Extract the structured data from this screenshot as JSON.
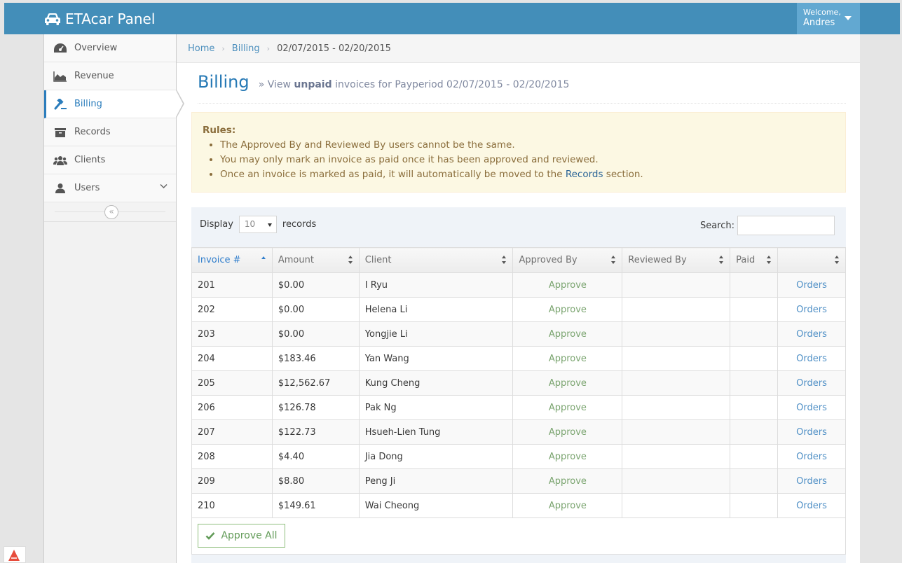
{
  "brand": {
    "title": "ETAcar Panel",
    "icon": "car-icon"
  },
  "user": {
    "welcome": "Welcome,",
    "name": "Andres"
  },
  "sidebar": {
    "items": [
      {
        "label": "Overview",
        "icon": "dashboard-icon"
      },
      {
        "label": "Revenue",
        "icon": "area-chart-icon"
      },
      {
        "label": "Billing",
        "icon": "gavel-icon",
        "active": true
      },
      {
        "label": "Records",
        "icon": "archive-icon"
      },
      {
        "label": "Clients",
        "icon": "users-icon"
      },
      {
        "label": "Users",
        "icon": "user-icon"
      }
    ],
    "collapse_glyph": "«"
  },
  "breadcrumb": {
    "home": "Home",
    "billing": "Billing",
    "current": "02/07/2015 - 02/20/2015"
  },
  "header": {
    "title": "Billing",
    "sub_prefix": "» View ",
    "sub_bold": "unpaid",
    "sub_suffix": " invoices for Payperiod 02/07/2015 - 02/20/2015"
  },
  "rules": {
    "title": "Rules:",
    "items": [
      "The Approved By and Reviewed By users cannot be the same.",
      "You may only mark an invoice as paid once it has been approved and reviewed."
    ],
    "third_prefix": "Once an invoice is marked as paid, it will automatically be moved to the ",
    "third_link": "Records",
    "third_suffix": " section."
  },
  "table_controls": {
    "display_label": "Display",
    "records_label": "records",
    "page_size": "10",
    "search_label": "Search:"
  },
  "table": {
    "columns": [
      "Invoice #",
      "Amount",
      "Client",
      "Approved By",
      "Reviewed By",
      "Paid",
      ""
    ],
    "rows": [
      {
        "invoice": "201",
        "amount": "$0.00",
        "client": "I Ryu",
        "approve": "Approve",
        "orders": "Orders"
      },
      {
        "invoice": "202",
        "amount": "$0.00",
        "client": "Helena Li",
        "approve": "Approve",
        "orders": "Orders"
      },
      {
        "invoice": "203",
        "amount": "$0.00",
        "client": "Yongjie Li",
        "approve": "Approve",
        "orders": "Orders"
      },
      {
        "invoice": "204",
        "amount": "$183.46",
        "client": "Yan Wang",
        "approve": "Approve",
        "orders": "Orders"
      },
      {
        "invoice": "205",
        "amount": "$12,562.67",
        "client": "Kung Cheng",
        "approve": "Approve",
        "orders": "Orders"
      },
      {
        "invoice": "206",
        "amount": "$126.78",
        "client": "Pak Ng",
        "approve": "Approve",
        "orders": "Orders"
      },
      {
        "invoice": "207",
        "amount": "$122.73",
        "client": "Hsueh-Lien Tung",
        "approve": "Approve",
        "orders": "Orders"
      },
      {
        "invoice": "208",
        "amount": "$4.40",
        "client": "Jia Dong",
        "approve": "Approve",
        "orders": "Orders"
      },
      {
        "invoice": "209",
        "amount": "$8.80",
        "client": "Peng Ji",
        "approve": "Approve",
        "orders": "Orders"
      },
      {
        "invoice": "210",
        "amount": "$149.61",
        "client": "Wai Cheong",
        "approve": "Approve",
        "orders": "Orders"
      }
    ]
  },
  "approve_all": "Approve All",
  "colors": {
    "navbar": "#438eb9",
    "link": "#4c8fbd",
    "approve_green": "#7aa46f",
    "alert_bg": "#fcf8e3"
  }
}
